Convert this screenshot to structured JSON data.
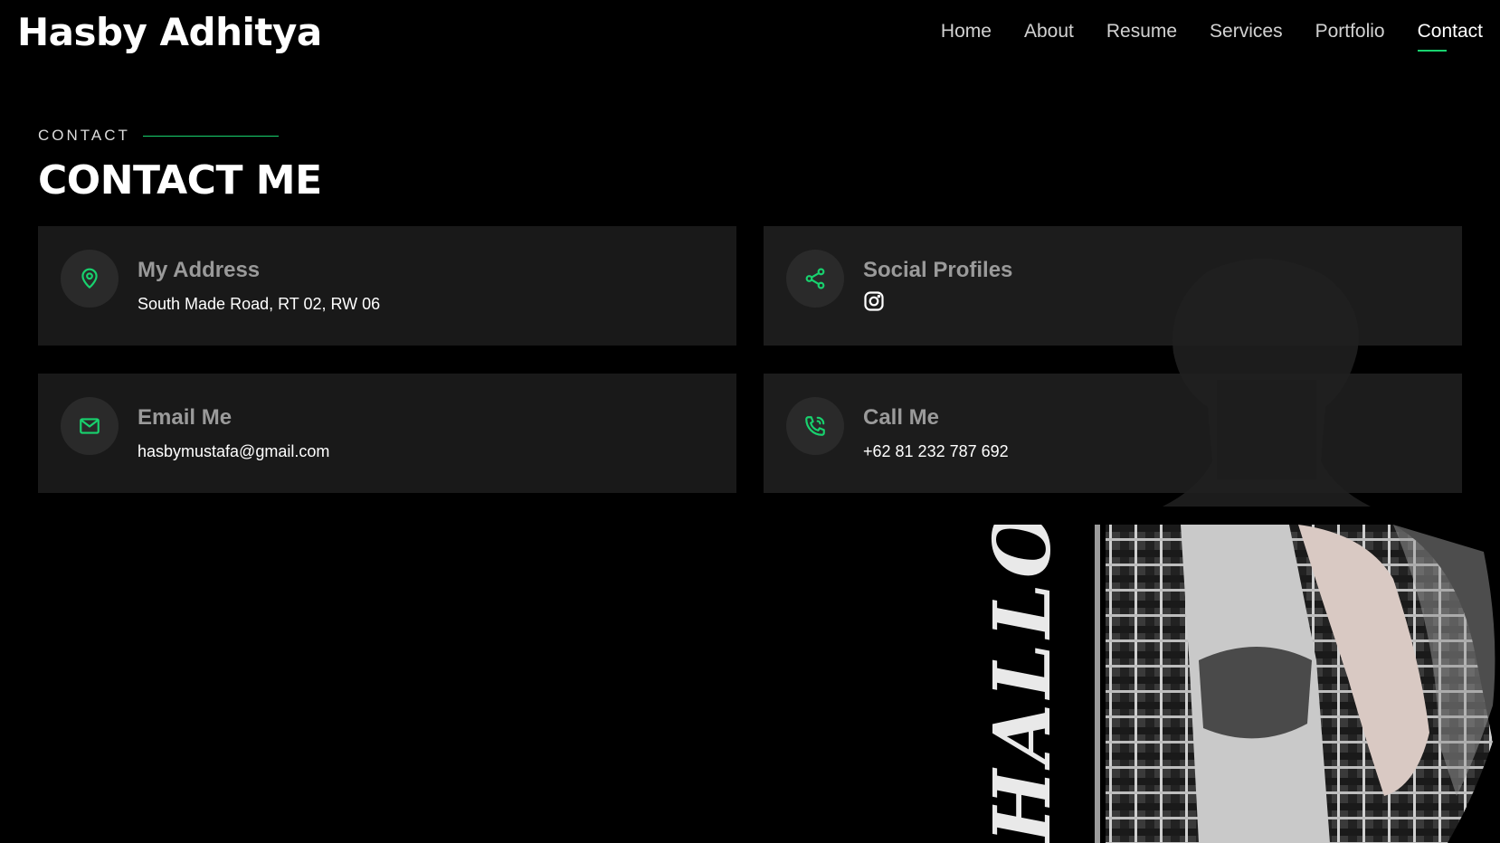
{
  "header": {
    "logo": "Hasby Adhitya",
    "nav": [
      {
        "label": "Home"
      },
      {
        "label": "About"
      },
      {
        "label": "Resume"
      },
      {
        "label": "Services"
      },
      {
        "label": "Portfolio"
      },
      {
        "label": "Contact",
        "active": true
      }
    ]
  },
  "section": {
    "kicker": "CONTACT",
    "heading": "CONTACT ME"
  },
  "cards": {
    "address": {
      "title": "My Address",
      "text": "South Made Road, RT 02, RW 06",
      "icon": "map-pin-icon"
    },
    "social": {
      "title": "Social Profiles",
      "icon": "share-icon",
      "link_icon": "instagram-icon"
    },
    "email": {
      "title": "Email Me",
      "text": "hasbymustafa@gmail.com",
      "icon": "mail-icon"
    },
    "call": {
      "title": "Call Me",
      "text": "+62 81 232 787 692",
      "icon": "phone-icon"
    }
  },
  "decor": {
    "hallo_text": "HALLO"
  },
  "colors": {
    "accent": "#18d26e",
    "background": "#000000",
    "card": "#191919"
  }
}
